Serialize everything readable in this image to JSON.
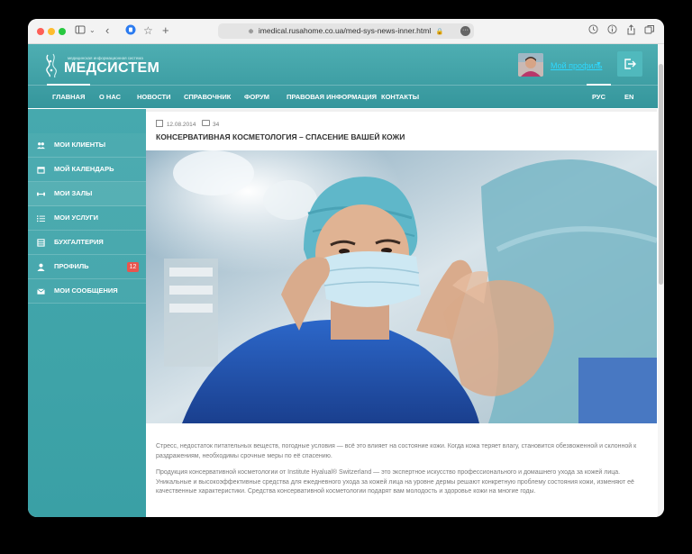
{
  "browser": {
    "url": "imedical.rusahome.co.ua/med-sys-news-inner.html"
  },
  "header": {
    "logo_text": "МЕДСИСТЕМ",
    "logo_tagline": "медицинская информационная система",
    "profile_label": "Мой профиль"
  },
  "nav": {
    "items": [
      {
        "label": "ГЛАВНАЯ"
      },
      {
        "label": "О НАС"
      },
      {
        "label": "НОВОСТИ"
      },
      {
        "label": "СПРАВОЧНИК"
      },
      {
        "label": "ФОРУМ"
      },
      {
        "label": "ПРАВОВАЯ ИНФОРМАЦИЯ"
      },
      {
        "label": "КОНТАКТЫ"
      }
    ],
    "languages": [
      {
        "label": "РУС"
      },
      {
        "label": "EN"
      }
    ]
  },
  "sidebar": {
    "items": [
      {
        "label": "МОИ КЛИЕНТЫ",
        "icon": "clients-icon"
      },
      {
        "label": "МОЙ КАЛЕНДАРЬ",
        "icon": "calendar-icon"
      },
      {
        "label": "МОИ ЗАЛЫ",
        "icon": "dumbbell-icon"
      },
      {
        "label": "МОИ УСЛУГИ",
        "icon": "list-icon"
      },
      {
        "label": "БУХГАЛТЕРИЯ",
        "icon": "ledger-icon"
      },
      {
        "label": "ПРОФИЛЬ",
        "icon": "user-icon",
        "badge": "12"
      },
      {
        "label": "МОИ СООБЩЕНИЯ",
        "icon": "envelope-icon"
      }
    ]
  },
  "article": {
    "date": "12.08.2014",
    "comments": "34",
    "title": "КОНСЕРВАТИВНАЯ КОСМЕТОЛОГИЯ – СПАСЕНИЕ ВАШЕЙ КОЖИ",
    "paragraphs": [
      "Стресс, недостаток питательных веществ, погодные условия — всё это влияет на состояние кожи. Когда кожа теряет влагу, становится обезвоженной и склонной к раздражениям, необходимы срочные меры по её спасению.",
      "Продукция консервативной косметологии от Institute Hyalual® Switzerland — это экспертное искусство профессионального и домашнего ухода за кожей лица. Уникальные и высокоэффективные средства для ежедневного ухода за кожей лица на уровне дермы решают конкретную проблему состояния кожи, изменяют её качественные характеристики. Средства консервативной косметологии подарят вам молодость и здоровье кожи на многие годы."
    ]
  },
  "colors": {
    "brand_teal": "#3aa0a5",
    "link_cyan": "#2dd8ff",
    "badge_red": "#e8554e"
  }
}
